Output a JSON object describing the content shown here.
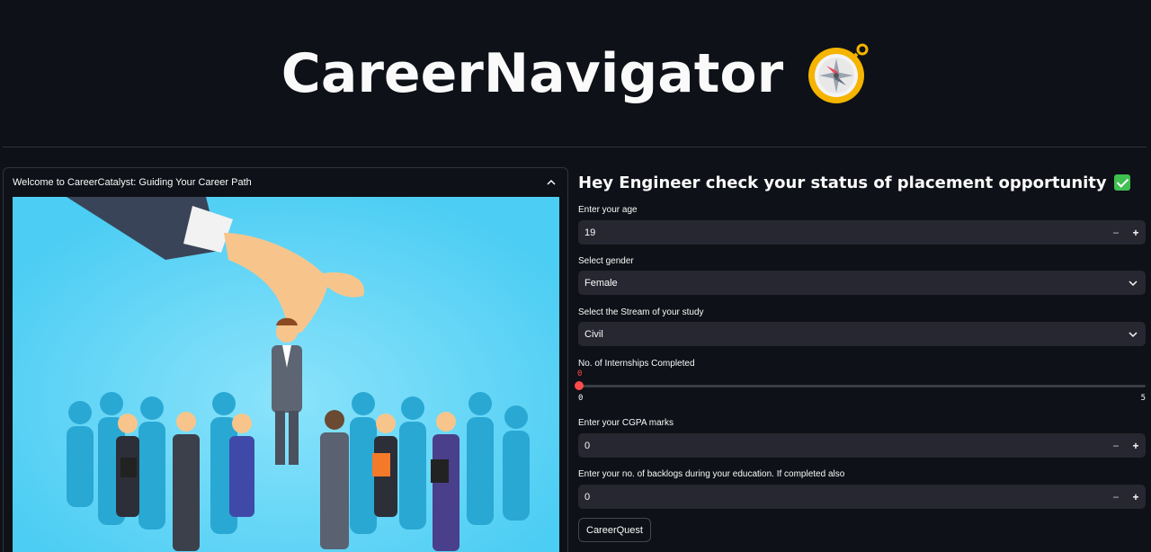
{
  "header": {
    "title": "CareerNavigator",
    "icon": "compass-icon"
  },
  "expander": {
    "title": "Welcome to CareerCatalyst: Guiding Your Career Path",
    "icon": "chevron-up-icon",
    "image": "hiring-illustration"
  },
  "form": {
    "heading": "Hey Engineer check your status of placement opportunity",
    "heading_icon": "check-mark-icon",
    "age": {
      "label": "Enter your age",
      "value": "19"
    },
    "gender": {
      "label": "Select gender",
      "value": "Female"
    },
    "stream": {
      "label": "Select the Stream of your study",
      "value": "Civil"
    },
    "internships": {
      "label": "No. of Internships Completed",
      "value": "0",
      "min": "0",
      "max": "5"
    },
    "cgpa": {
      "label": "Enter your CGPA marks",
      "value": "0"
    },
    "backlogs": {
      "label": "Enter your no. of backlogs during your education. If completed also",
      "value": "0"
    },
    "submit_label": "CareerQuest",
    "stepper_minus": "−",
    "stepper_plus": "+"
  },
  "colors": {
    "background": "#0e1117",
    "input": "#262730",
    "accent": "#ff4b4b",
    "image_bg": "#4fd0f5"
  }
}
